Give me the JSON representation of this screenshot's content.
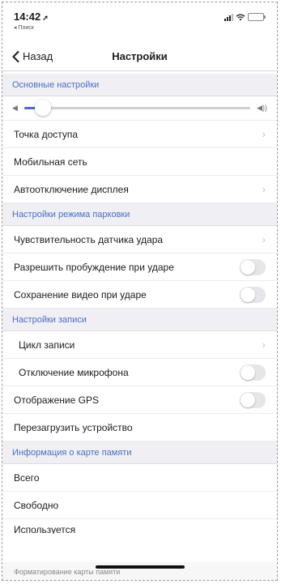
{
  "status_bar": {
    "time": "14:42",
    "location_glyph": "➚",
    "back_app": "◂ Поиск",
    "icons": [
      "signal-icon",
      "wifi-icon",
      "battery-icon"
    ]
  },
  "nav": {
    "back_label": "Назад",
    "title": "Настройки"
  },
  "sections": {
    "basic": "Основные настройки",
    "parking": "Настройки режима парковки",
    "recording": "Настройки записи",
    "memory": "Информация о карте памяти"
  },
  "volume": {
    "level": 0.06
  },
  "rows": {
    "hotspot": "Точка доступа",
    "mobile_network": "Мобильная сеть",
    "screen_off": "Автоотключение дисплея",
    "shock_sensitivity": "Чувствительность датчика удара",
    "wake_on_shock": "Разрешить пробуждение при ударе",
    "save_on_shock": "Сохранение видео при ударе",
    "record_cycle": "Цикл записи",
    "mic_off": "Отключение микрофона",
    "gps_display": "Отображение GPS",
    "reboot": "Перезагрузить устройство",
    "total": "Всего",
    "free": "Свободно",
    "used": "Используется"
  },
  "toggles": {
    "wake_on_shock": false,
    "save_on_shock": false,
    "mic_off": false,
    "gps_display": false
  },
  "bottom": {
    "partial_text": "Форматирование карты памяти"
  },
  "colors": {
    "accent": "#4a6fc4",
    "section_bg": "#efeff4"
  }
}
